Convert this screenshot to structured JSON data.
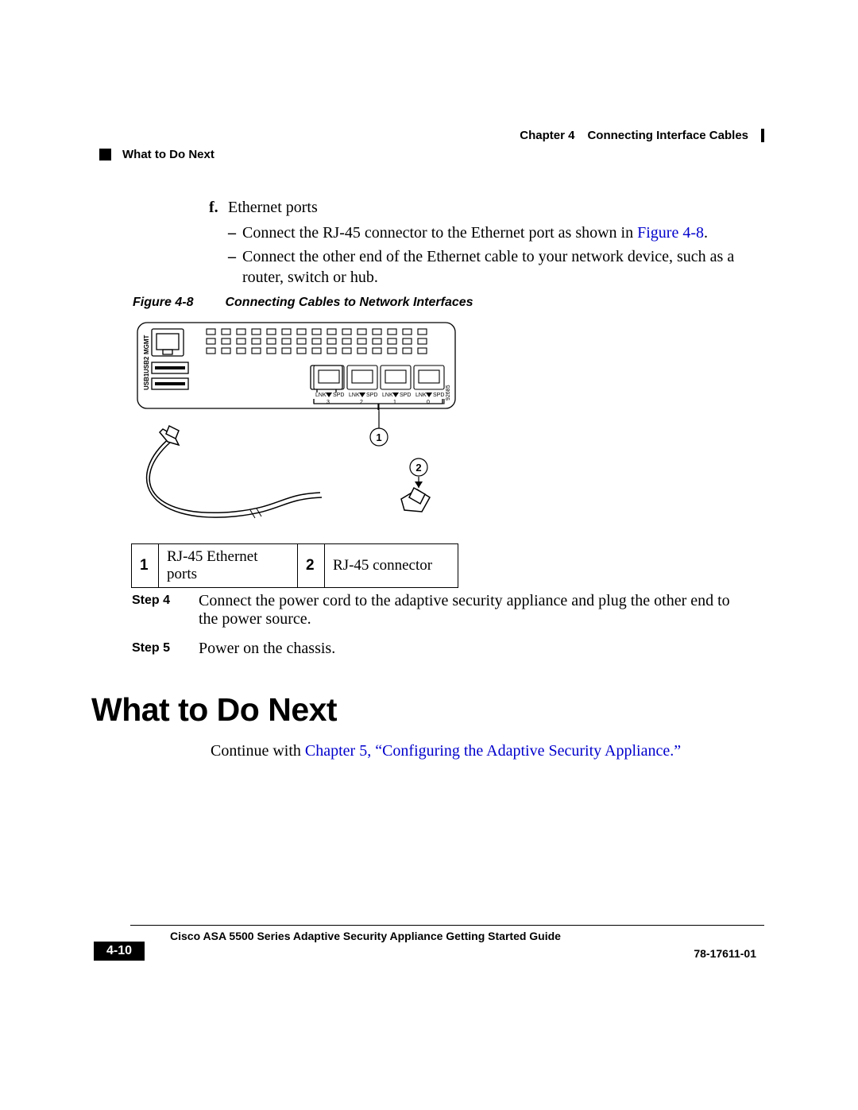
{
  "header": {
    "chapter": "Chapter 4",
    "chapter_title": "Connecting Interface Cables",
    "section": "What to Do Next"
  },
  "body": {
    "item_f_label": "f.",
    "item_f_text": "Ethernet ports",
    "dash1_pre": "Connect the RJ-45 connector to the Ethernet port as shown in ",
    "dash1_link": "Figure 4-8",
    "dash1_post": ".",
    "dash2": "Connect the other end of the Ethernet cable to your network device, such as a router, switch or hub."
  },
  "figure": {
    "label": "Figure 4-8",
    "caption": "Connecting Cables to Network Interfaces",
    "side_labels": {
      "mgmt": "MGMT",
      "usb2": "USB2",
      "usb1": "USB1"
    },
    "port_text_lnk": "LNK",
    "port_text_spd": "SPD",
    "port_numbers": [
      "3",
      "2",
      "1",
      "0"
    ],
    "callouts": {
      "c1": "1",
      "c2": "2"
    },
    "art_id": "92685"
  },
  "callout_table": {
    "r1_num": "1",
    "r1_text": "RJ-45 Ethernet ports",
    "r2_num": "2",
    "r2_text": "RJ-45 connector"
  },
  "steps": {
    "s4_label": "Step 4",
    "s4_text": "Connect the power cord to the adaptive security appliance and plug the other end to the power source.",
    "s5_label": "Step 5",
    "s5_text": "Power on the chassis."
  },
  "h1": "What to Do Next",
  "continue": {
    "pre": "Continue with ",
    "link": "Chapter 5, “Configuring the Adaptive Security Appliance.”"
  },
  "footer": {
    "book": "Cisco ASA 5500 Series Adaptive Security Appliance Getting Started Guide",
    "page": "4-10",
    "docnum": "78-17611-01"
  }
}
